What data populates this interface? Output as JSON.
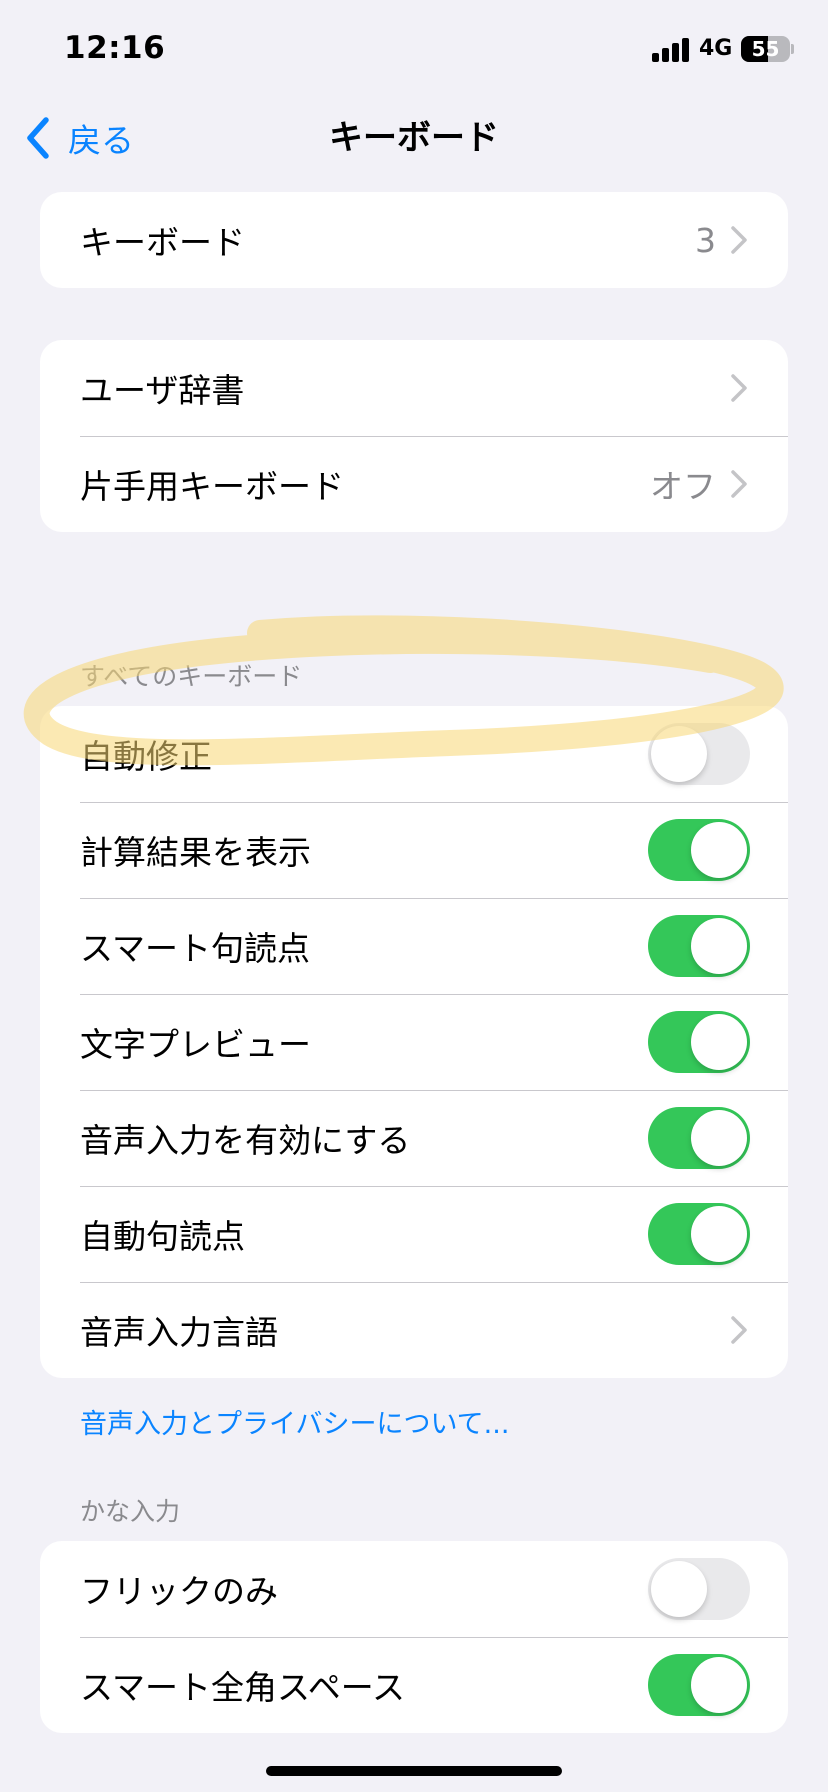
{
  "status_bar": {
    "time": "12:16",
    "network": "4G",
    "battery_level": "55",
    "battery_fraction": 0.55
  },
  "nav": {
    "back_label": "戻る",
    "title": "キーボード"
  },
  "groups": {
    "keyboards": {
      "label": "キーボード",
      "value": "3"
    },
    "general": {
      "user_dictionary": "ユーザ辞書",
      "one_handed": "片手用キーボード",
      "one_handed_value": "オフ"
    },
    "all_keyboards": {
      "header": "すべてのキーボード",
      "auto_correction": {
        "label": "自動修正",
        "on": false
      },
      "show_calculation": {
        "label": "計算結果を表示",
        "on": true
      },
      "smart_punctuation": {
        "label": "スマート句読点",
        "on": true
      },
      "character_preview": {
        "label": "文字プレビュー",
        "on": true
      },
      "enable_dictation": {
        "label": "音声入力を有効にする",
        "on": true
      },
      "auto_punctuation": {
        "label": "自動句読点",
        "on": true
      },
      "dictation_languages": "音声入力言語",
      "privacy_link": "音声入力とプライバシーについて..."
    },
    "kana_input": {
      "header": "かな入力",
      "flick_only": {
        "label": "フリックのみ",
        "on": false
      },
      "smart_fullwidth_space": {
        "label": "スマート全角スペース",
        "on": true
      }
    }
  },
  "colors": {
    "accent": "#0a84ff",
    "toggle_on": "#34c759",
    "toggle_off": "#e9e9eb",
    "background": "#f2f1f7",
    "highlight": "#f7d774"
  }
}
